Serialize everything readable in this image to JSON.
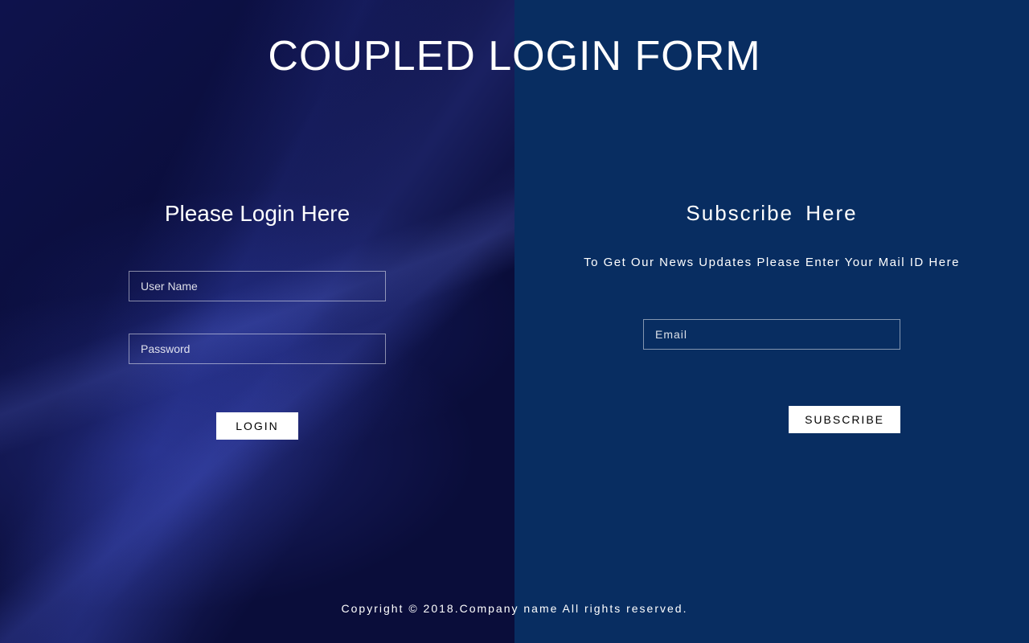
{
  "page_title": "COUPLED LOGIN FORM",
  "login": {
    "heading": "Please Login Here",
    "username_placeholder": "User Name",
    "password_placeholder": "Password",
    "button_label": "LOGIN"
  },
  "subscribe": {
    "heading": "Subscribe Here",
    "description": "To Get Our News Updates Please Enter Your Mail ID Here",
    "email_placeholder": "Email",
    "button_label": "SUBSCRIBE"
  },
  "footer": {
    "text": "Copyright © 2018.Company name All rights reserved."
  }
}
